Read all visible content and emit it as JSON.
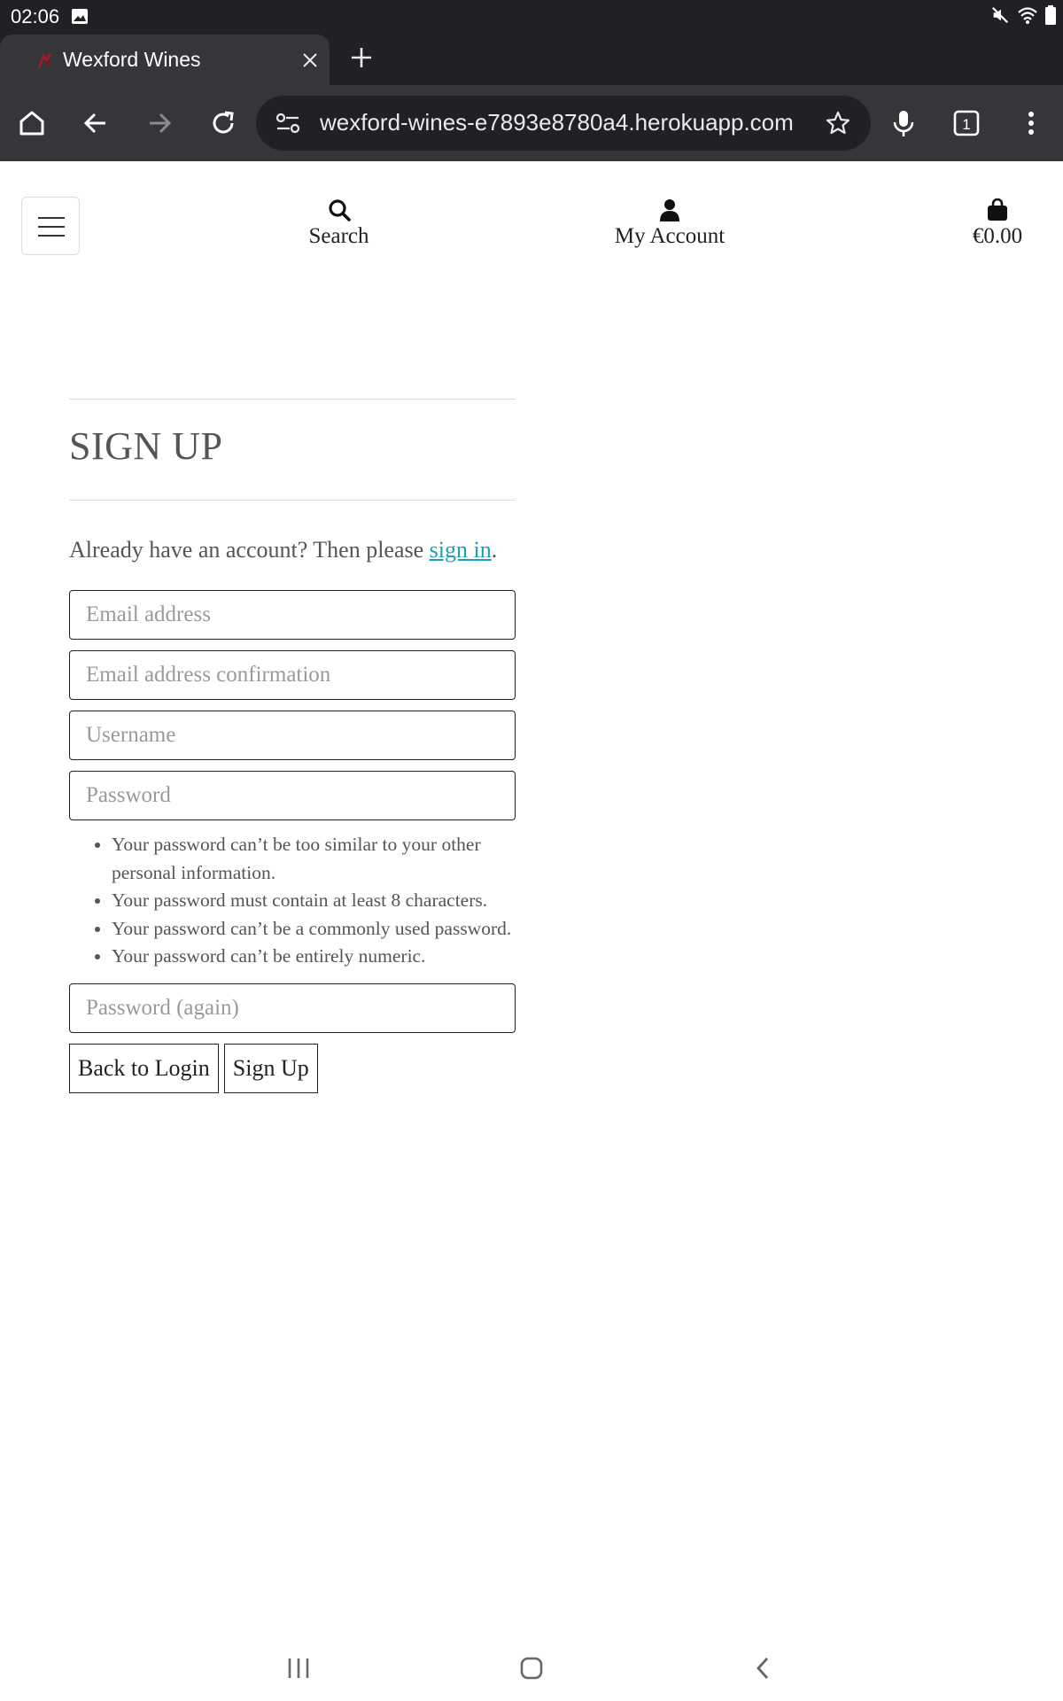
{
  "status_bar": {
    "time": "02:06",
    "icons": [
      "image-notification-icon",
      "mute-icon",
      "wifi-icon",
      "battery-icon"
    ]
  },
  "browser": {
    "tab": {
      "title": "Wexford Wines",
      "favicon": "wine-favicon-icon",
      "close_icon": "close-icon"
    },
    "new_tab_icon": "plus-icon",
    "toolbar": {
      "icons": [
        "home-icon",
        "back-arrow-icon",
        "forward-arrow-icon",
        "reload-icon",
        "mic-icon",
        "tab-count-icon",
        "more-vert-icon"
      ],
      "url": "wexford-wines-e7893e8780a4.herokuapp.com",
      "tab_count": "1"
    }
  },
  "header": {
    "menu_icon": "hamburger-icon",
    "search_label": "Search",
    "account_label": "My Account",
    "bag_total": "€0.00"
  },
  "signup": {
    "title": "SIGN UP",
    "intro_text": "Already have an account? Then please ",
    "intro_link": "sign in",
    "intro_end": ".",
    "email_placeholder": "Email address",
    "email_confirm_placeholder": "Email address confirmation",
    "username_placeholder": "Username",
    "password_placeholder": "Password",
    "password_help": [
      "Your password can’t be too similar to your other personal information.",
      "Your password must contain at least 8 characters.",
      "Your password can’t be a commonly used password.",
      "Your password can’t be entirely numeric."
    ],
    "password_again_placeholder": "Password (again)",
    "back_button": "Back to Login",
    "submit_button": "Sign Up"
  },
  "colors": {
    "browser_dark": "#202124",
    "browser_toolbar": "#35363a",
    "link": "#17a2b8",
    "text": "#555555"
  }
}
